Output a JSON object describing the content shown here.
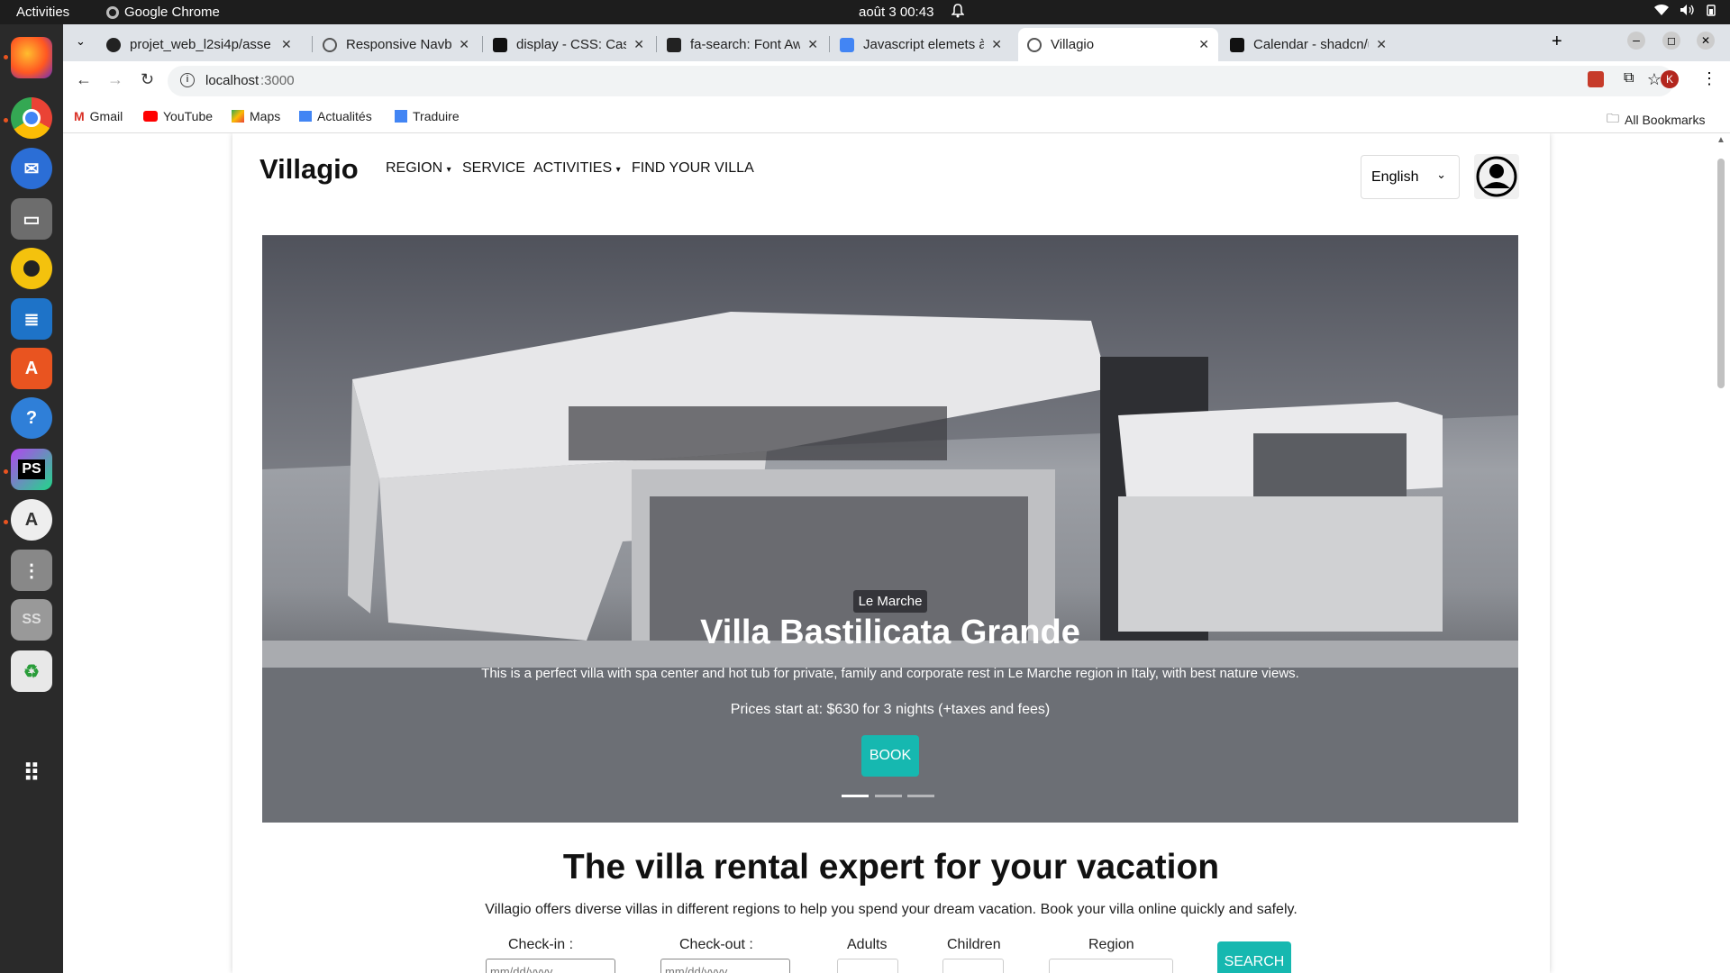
{
  "os": {
    "activities": "Activities",
    "app_name": "Google Chrome",
    "clock": "août 3  00:43"
  },
  "tabs": [
    {
      "title": "projet_web_l2si4p/asse",
      "color": "#222"
    },
    {
      "title": "Responsive Navbar Adj",
      "color": "#555"
    },
    {
      "title": "display - CSS: Cascading",
      "color": "#111"
    },
    {
      "title": "fa-search: Font Aweson",
      "color": "#222"
    },
    {
      "title": "Javascript elemets à co",
      "color": "#4285f4"
    },
    {
      "title": "Villagio",
      "color": "#777"
    },
    {
      "title": "Calendar - shadcn/ui",
      "color": "#111"
    }
  ],
  "address": {
    "host": "localhost",
    "port": ":3000"
  },
  "bookmarks": [
    "Gmail",
    "YouTube",
    "Maps",
    "Actualités",
    "Traduire"
  ],
  "all_bookmarks": "All Bookmarks",
  "profile_initial": "K",
  "site": {
    "brand": "Villagio",
    "nav": [
      "REGION",
      "SERVICE",
      "ACTIVITIES",
      "FIND YOUR VILLA"
    ],
    "language": "English",
    "hero": {
      "badge": "Le Marche",
      "title": "Villa Bastilicata Grande",
      "desc": "This is a perfect villa with spa center and hot tub for private, family and corporate rest in Le Marche region in Italy, with best nature views.",
      "price": "Prices start at: $630 for 3 nights (+taxes and fees)",
      "book": "BOOK",
      "slides": 3,
      "active_slide": 1
    },
    "heading": "The villa rental expert for your vacation",
    "subheading": "Villagio offers diverse villas in different regions to help you spend your dream vacation. Book your villa online quickly and safely.",
    "form": {
      "checkin": "Check-in :",
      "checkout": "Check-out :",
      "adults": "Adults",
      "children": "Children",
      "region": "Region",
      "search": "SEARCH",
      "date_placeholder": "mm/dd/yyyy"
    }
  }
}
